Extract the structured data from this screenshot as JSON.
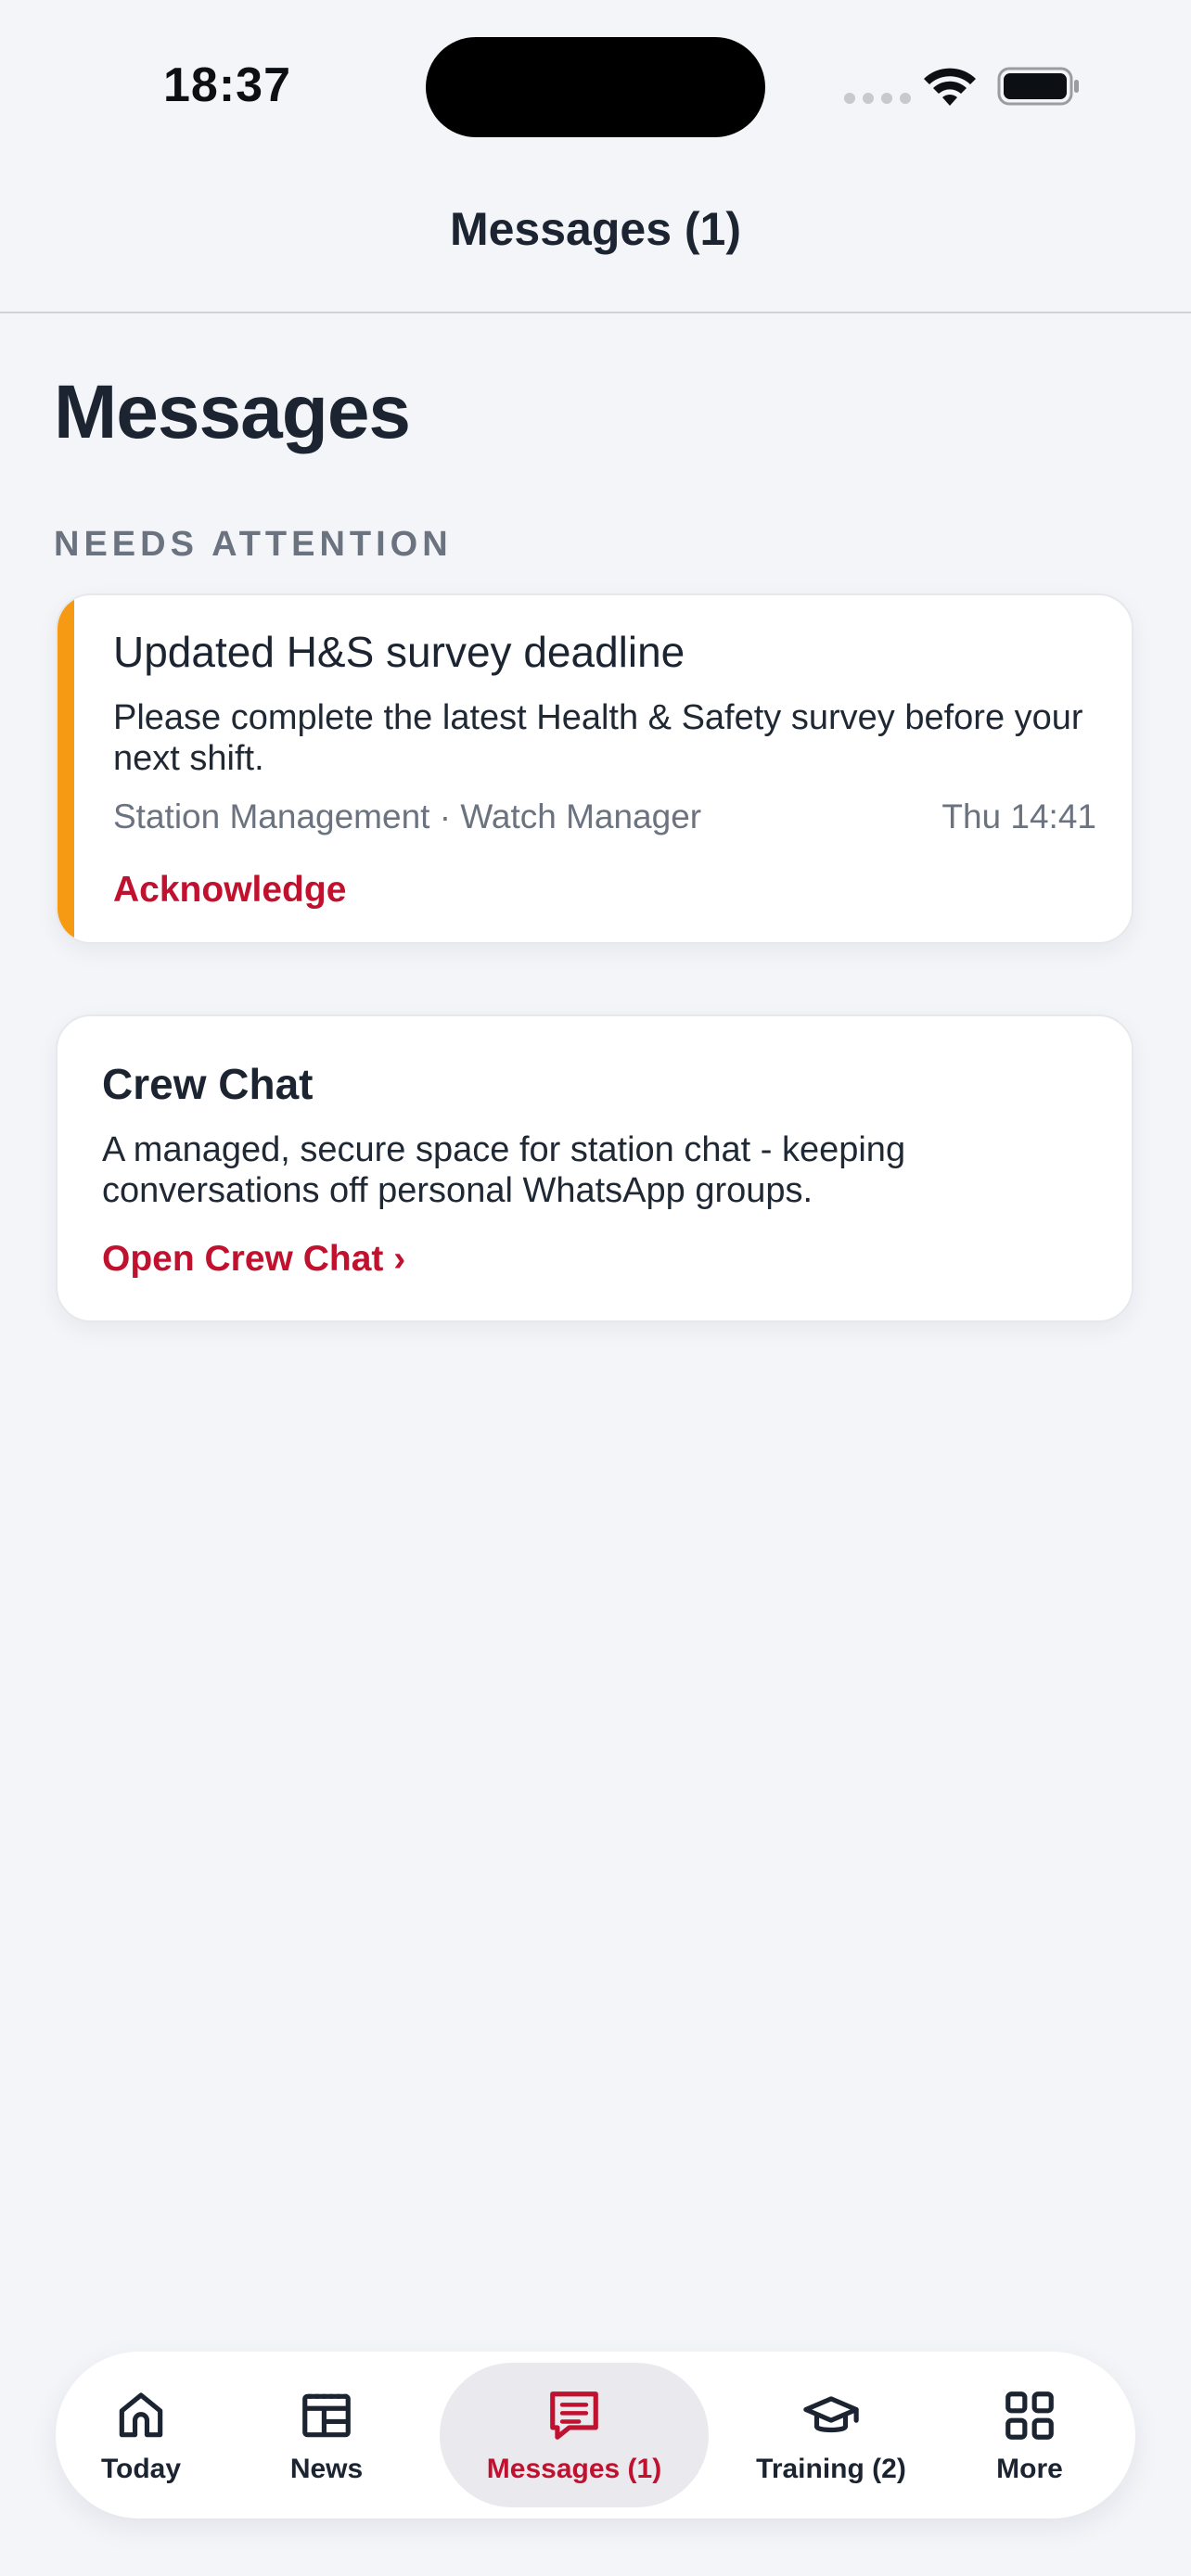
{
  "status_bar": {
    "time": "18:37"
  },
  "header": {
    "title": "Messages (1)"
  },
  "page": {
    "title": "Messages",
    "section_label": "NEEDS ATTENTION"
  },
  "message": {
    "title": "Updated H&S survey deadline",
    "body": "Please complete the latest Health & Safety survey before your next shift.",
    "meta": "Station Management · Watch Manager",
    "time": "Thu 14:41",
    "action_label": "Acknowledge",
    "accent_color": "#f59a12"
  },
  "crew_chat": {
    "title": "Crew Chat",
    "body": "A managed, secure space for station chat - keeping conversations off personal WhatsApp groups.",
    "link_label": "Open Crew Chat ›"
  },
  "tab_bar": {
    "items": [
      {
        "label": "Today",
        "icon": "home-icon"
      },
      {
        "label": "News",
        "icon": "newspaper-icon"
      },
      {
        "label": "Messages (1)",
        "icon": "message-icon",
        "active": true
      },
      {
        "label": "Training (2)",
        "icon": "graduation-cap-icon"
      },
      {
        "label": "More",
        "icon": "grid-icon"
      }
    ]
  },
  "colors": {
    "brand": "#c0112f",
    "text": "#1b2430",
    "muted": "#6b7380",
    "background": "#f4f5f9"
  }
}
